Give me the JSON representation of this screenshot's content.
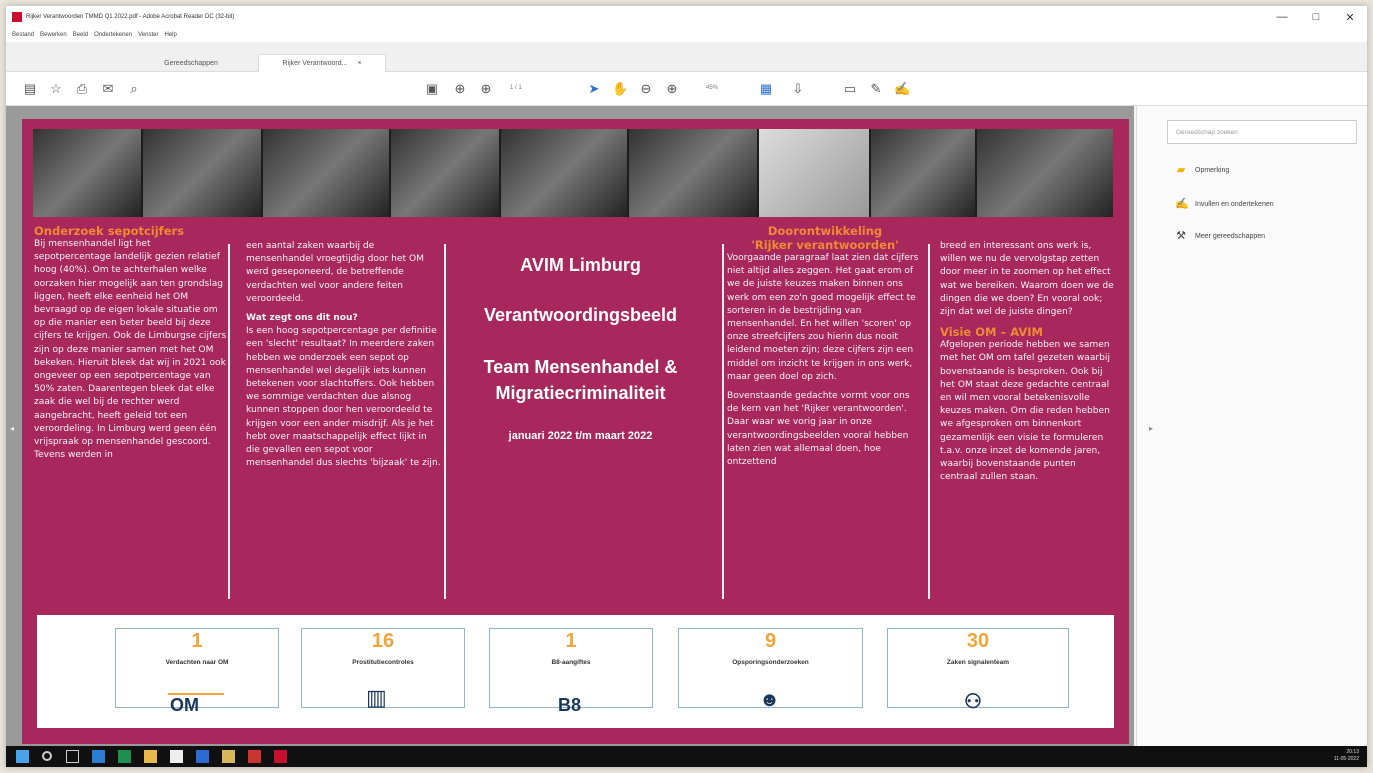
{
  "window": {
    "title": "Rijker Verantwoorden TMMD Q1 2022.pdf - Adobe Acrobat Reader DC (32-bit)",
    "minimize": "—",
    "maximize": "□",
    "close": "✕"
  },
  "menu": [
    "Bestand",
    "Bewerken",
    "Beeld",
    "Ondertekenen",
    "Venster",
    "Help"
  ],
  "tabs": [
    "Gereedschappen",
    "Rijker Verantwoord...",
    "×"
  ],
  "toolbar": {
    "page_indicator": "1 / 1",
    "zoom": "45%"
  },
  "document": {
    "col1": {
      "heading": "Onderzoek sepotcijfers",
      "body": "Bij mensenhandel ligt het sepotpercentage landelijk gezien relatief hoog (40%). Om te achterhalen welke oorzaken hier mogelijk aan ten grondslag liggen, heeft elke eenheid het OM bevraagd op de eigen lokale situatie om op die manier een beter beeld bij deze cijfers te krijgen. Ook de Limburgse cijfers zijn op deze manier samen met het OM bekeken. Hieruit bleek dat wij in 2021 ook ongeveer op een sepotpercentage van 50% zaten. Daarentegen bleek dat elke zaak die wel bij de rechter werd aangebracht, heeft geleid tot een veroordeling. In Limburg werd geen één vrijspraak op mensenhandel gescoord. Tevens werden in"
    },
    "col2": {
      "body1": "een aantal zaken waarbij de mensenhandel vroegtijdig door het OM werd geseponeerd, de betreffende verdachten wel voor andere feiten veroordeeld.",
      "subheading": "Wat zegt ons dit nou?",
      "body2": "Is een hoog sepotpercentage per definitie een 'slecht' resultaat? In meerdere zaken hebben we onderzoek een sepot op mensenhandel wel degelijk iets kunnen betekenen voor slachtoffers. Ook hebben we sommige verdachten due alsnog kunnen stoppen door hen veroordeeld te krijgen voor een ander misdrijf. Als je het hebt over maatschappelijk effect lijkt in die gevallen een sepot voor mensenhandel dus slechts 'bijzaak' te zijn."
    },
    "center": {
      "line1": "AVIM Limburg",
      "line2": "Verantwoordingsbeeld",
      "line3": "Team Mensenhandel & Migratiecriminaliteit",
      "period": "januari 2022 t/m maart 2022"
    },
    "col4": {
      "heading1": "Doorontwikkeling",
      "heading2": "'Rijker verantwoorden'",
      "body1": "Voorgaande paragraaf laat zien dat cijfers niet altijd alles zeggen. Het gaat erom of we de juiste keuzes maken binnen ons werk om een zo'n goed mogelijk effect te sorteren in de bestrijding van mensenhandel. En het willen 'scoren' op onze streefcijfers zou hierin dus nooit leidend moeten zijn; deze cijfers zijn een middel om inzicht te krijgen in ons werk, maar geen doel op zich.",
      "body2": "Bovenstaande gedachte vormt voor ons de kern van het 'Rijker verantwoorden'. Daar waar we vorig jaar in onze verantwoordingsbeelden vooral hebben laten zien wat allemaal doen, hoe ontzettend"
    },
    "col5": {
      "body1": "breed en interessant ons werk is, willen we nu de vervolgstap zetten door meer in te zoomen op het effect wat we bereiken. Waarom doen we de dingen die we doen? En vooral ook; zijn dat wel de juiste dingen?",
      "heading": "Visie OM – AVIM",
      "body2": "Afgelopen periode hebben we samen met het OM om tafel gezeten waarbij bovenstaande is besproken. Ook bij het OM staat deze gedachte centraal en wil men vooral betekenisvolle keuzes maken. Om die reden hebben we afgesproken om binnenkort gezamenlijk een visie te formuleren t.a.v. onze inzet de komende jaren, waarbij bovenstaande punten centraal zullen staan."
    },
    "stats": [
      {
        "value": "1",
        "label": "Verdachten naar OM",
        "icon_text": "OM"
      },
      {
        "value": "16",
        "label": "Prostitutiecontroles",
        "icon_text": ""
      },
      {
        "value": "1",
        "label": "B8-aangiftes",
        "icon_text": "B8"
      },
      {
        "value": "9",
        "label": "Opsporingsonderzoeken",
        "icon_text": ""
      },
      {
        "value": "30",
        "label": "Zaken signalenteam",
        "icon_text": ""
      }
    ]
  },
  "sidebar": {
    "search_placeholder": "Gereedschap zoeken",
    "items": [
      {
        "label": "Opmerking",
        "icon": "comment-icon"
      },
      {
        "label": "Invullen en ondertekenen",
        "icon": "sign-icon"
      },
      {
        "label": "Meer gereedschappen",
        "icon": "tools-icon"
      }
    ]
  },
  "taskbar": {
    "time": "20:13",
    "date": "11-05-2022"
  },
  "colors": {
    "page_bg": "#a8285d",
    "heading_orange": "#f08a34",
    "stat_number": "#f0a53a",
    "stat_icon": "#19365a"
  }
}
